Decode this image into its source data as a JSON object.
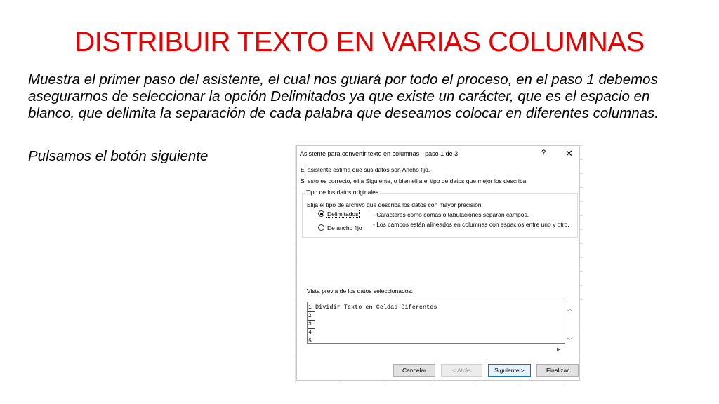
{
  "slide": {
    "title": "DISTRIBUIR TEXTO EN VARIAS COLUMNAS",
    "paragraph1": "Muestra el primer paso del asistente, el cual nos guiará por todo el proceso, en el paso 1 debemos asegurarnos de seleccionar la opción Delimitados ya que existe un carácter, que es el espacio en blanco, que delimita la separación de cada palabra que deseamos colocar en diferentes columnas.",
    "paragraph2": "Pulsamos el botón siguiente"
  },
  "dialog": {
    "title": "Asistente para convertir texto en columnas - paso 1 de 3",
    "help_glyph": "?",
    "close_glyph": "✕",
    "line1": "El asistente estima que sus datos son Ancho fijo.",
    "line2": "Si esto es correcto, elija Siguiente, o bien elija el tipo de datos que mejor los describa.",
    "group_title": "Tipo de los datos originales",
    "group_prompt": "Elija el tipo de archivo que describa los datos con mayor precisión:",
    "options": [
      {
        "label": "Delimitados",
        "description": "- Caracteres como comas o tabulaciones separan campos.",
        "selected": true
      },
      {
        "label": "De ancho fijo",
        "description": "- Los campos están alineados en columnas con espacios entre uno y otro.",
        "selected": false
      }
    ],
    "preview_label": "Vista previa de los datos seleccionados:",
    "preview_rows": [
      "1",
      "2",
      "3",
      "4",
      "5"
    ],
    "preview_text": "Dividir Texto en Celdas Diferentes",
    "buttons": {
      "cancel": "Cancelar",
      "back": "< Atrás",
      "next": "Siguiente >",
      "finish": "Finalizar"
    }
  }
}
